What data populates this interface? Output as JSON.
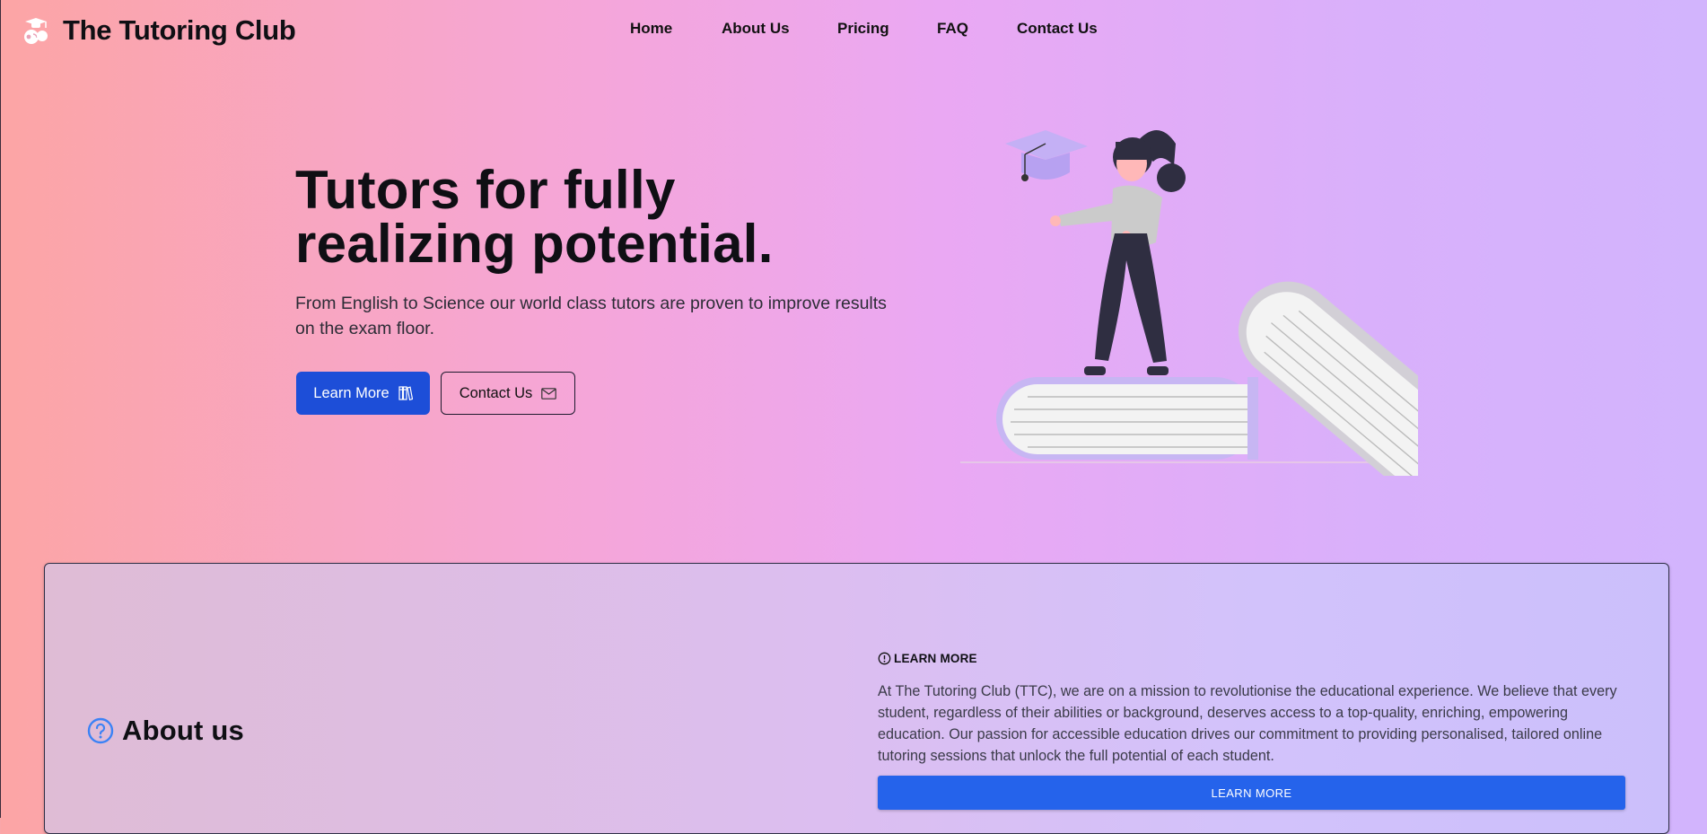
{
  "brand": {
    "name": "The Tutoring Club",
    "icon": "graduate-cap-icon"
  },
  "nav": {
    "items": [
      "Home",
      "About Us",
      "Pricing",
      "FAQ",
      "Contact Us"
    ]
  },
  "hero": {
    "title_line1": "Tutors for fully",
    "title_line2": "realizing potential.",
    "subtitle": "From English to Science our world class tutors are proven to improve results on the exam floor.",
    "primary_button": {
      "label": "Learn More",
      "icon": "books-icon"
    },
    "secondary_button": {
      "label": "Contact Us",
      "icon": "envelope-icon"
    }
  },
  "about": {
    "heading": "About us",
    "heading_icon": "question-circle-icon",
    "eyebrow": "LEARN MORE",
    "eyebrow_icon": "info-circle-icon",
    "body": "At The Tutoring Club (TTC), we are on a mission to revolutionise the educational experience. We believe that every student, regardless of their abilities or background, deserves access to a top-quality, enriching, empowering education. Our passion for accessible education drives our commitment to providing personalised, tailored online tutoring sessions that unlock the full potential of each student.",
    "button_label": "LEARN MORE"
  },
  "colors": {
    "primary": "#1d4ed8",
    "accent_blue": "#2563eb",
    "ink": "#0f0f14"
  }
}
